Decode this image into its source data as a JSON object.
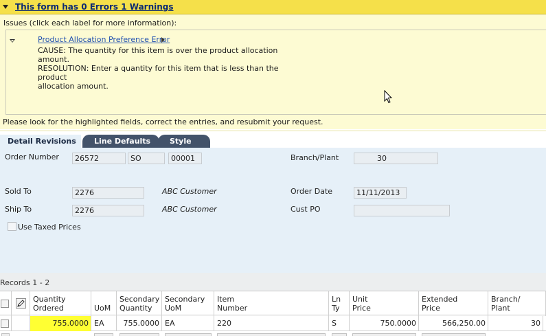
{
  "banner": {
    "title": "This form has 0 Errors 1 Warnings",
    "issues_label": "Issues (click each label for more information):",
    "issue": {
      "link": "Product Allocation Preference Error",
      "cause_1": "CAUSE: The quantity for this item is over the product allocation",
      "cause_2": "amount.",
      "resolution_1": "RESOLUTION: Enter a quantity for this item that is less than the product",
      "resolution_2": "allocation amount."
    },
    "footer": "Please look for the highlighted fields, correct the entries, and resubmit your request."
  },
  "tabs": [
    "Detail Revisions",
    "Line Defaults",
    "Style"
  ],
  "form": {
    "order_number_label": "Order Number",
    "order_number": "26572",
    "order_type": "SO",
    "order_company": "00001",
    "branch_plant_label": "Branch/Plant",
    "branch_plant": "30",
    "sold_to_label": "Sold To",
    "sold_to": "2276",
    "sold_to_name": "ABC Customer",
    "order_date_label": "Order Date",
    "order_date": "11/11/2013",
    "ship_to_label": "Ship To",
    "ship_to": "2276",
    "ship_to_name": "ABC Customer",
    "cust_po_label": "Cust PO",
    "cust_po": "",
    "use_taxed_prices_label": "Use Taxed Prices"
  },
  "grid": {
    "records_label": "Records 1 - 2",
    "columns": [
      {
        "l1": "Quantity",
        "l2": "Ordered"
      },
      {
        "l1": "UoM",
        "l2": ""
      },
      {
        "l1": "Secondary",
        "l2": "Quantity"
      },
      {
        "l1": "Secondary",
        "l2": "UoM"
      },
      {
        "l1": "Item",
        "l2": "Number"
      },
      {
        "l1": "Ln",
        "l2": "Ty"
      },
      {
        "l1": "Unit",
        "l2": "Price"
      },
      {
        "l1": "Extended",
        "l2": "Price"
      },
      {
        "l1": "Branch/",
        "l2": "Plant"
      }
    ],
    "rows": [
      {
        "quantity_ordered": "755.0000",
        "uom": "EA",
        "secondary_quantity": "755.0000",
        "secondary_uom": "EA",
        "item_number": "220",
        "ln_ty": "S",
        "unit_price": "750.0000",
        "extended_price": "566,250.00",
        "branch_plant": "30"
      }
    ]
  },
  "colors": {
    "banner_header": "#f5e04a",
    "banner_body": "#fdfbd3",
    "form_bg": "#e6f0f8",
    "tab_dark": "#43536a",
    "highlight": "#ffff33"
  },
  "icons": [
    "collapse-triangle-icon",
    "expand-arrow-icon",
    "edit-pencil-icon",
    "mouse-cursor-icon"
  ]
}
